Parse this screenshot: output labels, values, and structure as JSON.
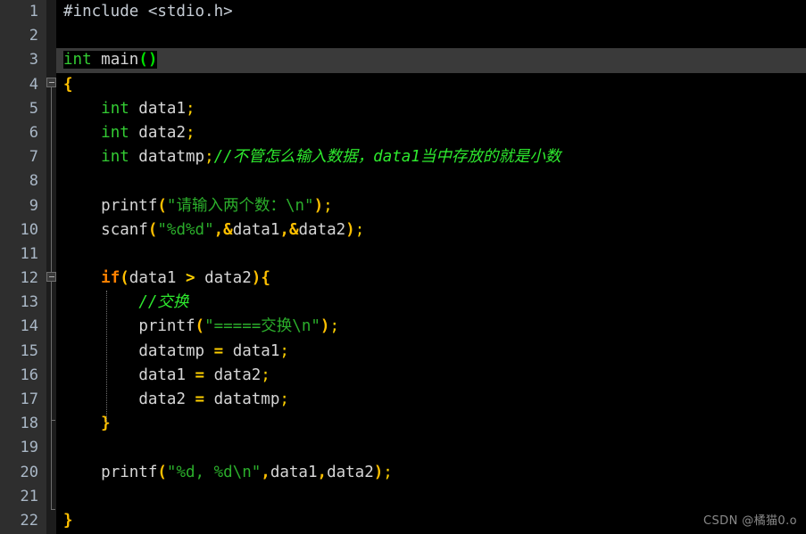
{
  "editor": {
    "language": "C",
    "theme": {
      "background": "#000000",
      "gutter_background": "#2e2e2e",
      "fold_column_background": "#1c1c1c",
      "line_number_color": "#a9b7c6",
      "current_line_highlight": "#3a3a3a",
      "identifier_color": "#d6d6d6",
      "keyword_type_color": "#33cc33",
      "keyword_control_color": "#ff8000",
      "punctuation_color": "#ffc000",
      "string_color": "#2bae2b",
      "comment_color": "#2eea2e",
      "preprocessor_color": "#c5ccd4",
      "watermark_color": "#8a8a8a"
    },
    "current_line": 3,
    "total_lines": 22,
    "line_numbers": [
      "1",
      "2",
      "3",
      "4",
      "5",
      "6",
      "7",
      "8",
      "9",
      "10",
      "11",
      "12",
      "13",
      "14",
      "15",
      "16",
      "17",
      "18",
      "19",
      "20",
      "21",
      "22"
    ],
    "fold_markers": [
      {
        "line": 4,
        "type": "minus-square",
        "region_end_line": 22
      },
      {
        "line": 12,
        "type": "minus-square",
        "region_end_line": 18
      }
    ]
  },
  "code": {
    "lines": [
      {
        "n": 1,
        "text": "#include <stdio.h>"
      },
      {
        "n": 2,
        "text": ""
      },
      {
        "n": 3,
        "text": "int main()"
      },
      {
        "n": 4,
        "text": "{"
      },
      {
        "n": 5,
        "text": "    int data1;"
      },
      {
        "n": 6,
        "text": "    int data2;"
      },
      {
        "n": 7,
        "text": "    int datatmp;//不管怎么输入数据，data1当中存放的就是小数"
      },
      {
        "n": 8,
        "text": ""
      },
      {
        "n": 9,
        "text": "    printf(\"请输入两个数：\\n\");"
      },
      {
        "n": 10,
        "text": "    scanf(\"%d%d\",&data1,&data2);"
      },
      {
        "n": 11,
        "text": ""
      },
      {
        "n": 12,
        "text": "    if(data1 > data2){"
      },
      {
        "n": 13,
        "text": "        //交换"
      },
      {
        "n": 14,
        "text": "        printf(\"=====交换\\n\");"
      },
      {
        "n": 15,
        "text": "        datatmp = data1;"
      },
      {
        "n": 16,
        "text": "        data1 = data2;"
      },
      {
        "n": 17,
        "text": "        data2 = datatmp;"
      },
      {
        "n": 18,
        "text": "    }"
      },
      {
        "n": 19,
        "text": ""
      },
      {
        "n": 20,
        "text": "    printf(\"%d, %d\\n\",data1,data2);"
      },
      {
        "n": 21,
        "text": ""
      },
      {
        "n": 22,
        "text": "}"
      }
    ],
    "tokens": {
      "l1_preproc": "#include <stdio.h>",
      "l3_kw": "int",
      "l3_space": " ",
      "l3_fn": "main",
      "l3_parens": "()",
      "l4_brace": "{",
      "l5_indent": "    ",
      "l5_kw": "int",
      "l5_name": " data1",
      "l5_semi": ";",
      "l6_kw": "int",
      "l6_name": " data2",
      "l6_semi": ";",
      "l7_kw": "int",
      "l7_name": " datatmp",
      "l7_semi": ";",
      "l7_comment": "//不管怎么输入数据，data1当中存放的就是小数",
      "l9_fn": "printf",
      "l9_lparen": "(",
      "l9_string": "\"请输入两个数：\\n\"",
      "l9_rparen": ")",
      "l9_semi": ";",
      "l10_fn": "scanf",
      "l10_lparen": "(",
      "l10_string": "\"%d%d\"",
      "l10_comma1": ",",
      "l10_amp1": "&",
      "l10_arg1": "data1",
      "l10_comma2": ",",
      "l10_amp2": "&",
      "l10_arg2": "data2",
      "l10_rparen": ")",
      "l10_semi": ";",
      "l12_if": "if",
      "l12_lparen": "(",
      "l12_a": "data1",
      "l12_op": " > ",
      "l12_b": "data2",
      "l12_rparen": ")",
      "l12_lbrace": "{",
      "l13_comment": "//交换",
      "l14_fn": "printf",
      "l14_lparen": "(",
      "l14_string": "\"=====交换\\n\"",
      "l14_rparen": ")",
      "l14_semi": ";",
      "l15_lhs": "datatmp",
      "l15_eq": " = ",
      "l15_rhs": "data1",
      "l15_semi": ";",
      "l16_lhs": "data1",
      "l16_eq": " = ",
      "l16_rhs": "data2",
      "l16_semi": ";",
      "l17_lhs": "data2",
      "l17_eq": " = ",
      "l17_rhs": "datatmp",
      "l17_semi": ";",
      "l18_rbrace": "}",
      "l20_fn": "printf",
      "l20_lparen": "(",
      "l20_string": "\"%d, %d\\n\"",
      "l20_comma1": ",",
      "l20_arg1": "data1",
      "l20_comma2": ",",
      "l20_arg2": "data2",
      "l20_rparen": ")",
      "l20_semi": ";",
      "l22_rbrace": "}"
    }
  },
  "watermark": {
    "text": "CSDN @橘猫0.o"
  }
}
